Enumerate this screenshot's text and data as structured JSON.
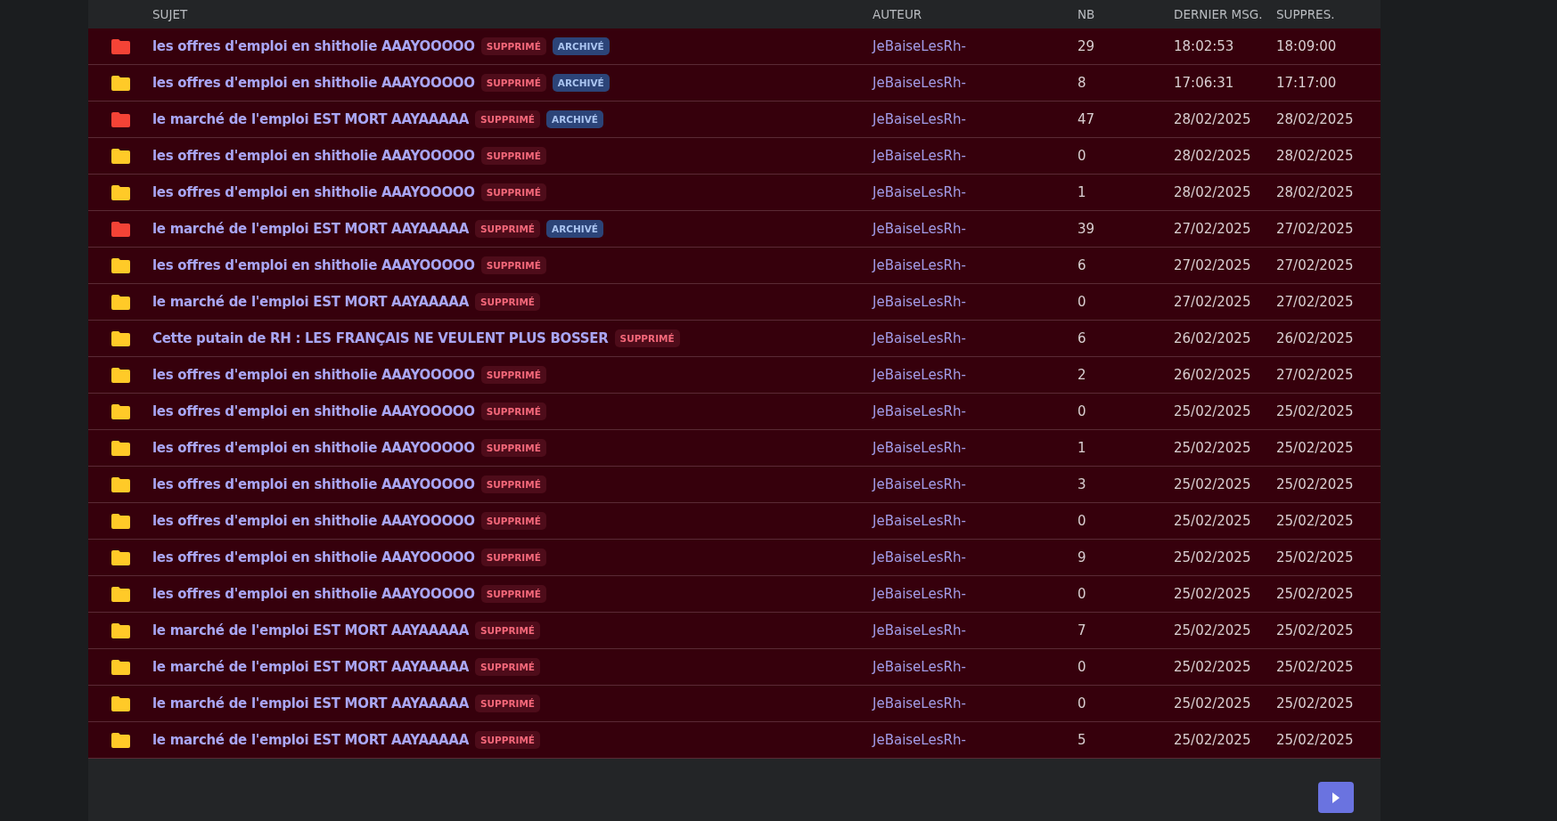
{
  "table": {
    "columns": [
      "SUJET",
      "AUTEUR",
      "NB",
      "DERNIER MSG.",
      "SUPPRES."
    ],
    "rows": [
      {
        "color": "#f44336",
        "subject": "les offres d'emploi en shitholie AAAYOOOOO",
        "badges": [
          {
            "kind": "deleted",
            "label": "SUPPRIMÉ"
          },
          {
            "kind": "archived",
            "label": "ARCHIVÉ"
          }
        ],
        "author": "JeBaiseLesRh-",
        "count": "29",
        "last": "18:02:53",
        "deleted_at": "18:09:00"
      },
      {
        "color": "#ffca28",
        "subject": "les offres d'emploi en shitholie AAAYOOOOO",
        "badges": [
          {
            "kind": "deleted",
            "label": "SUPPRIMÉ"
          },
          {
            "kind": "archived",
            "label": "ARCHIVÉ"
          }
        ],
        "author": "JeBaiseLesRh-",
        "count": "8",
        "last": "17:06:31",
        "deleted_at": "17:17:00"
      },
      {
        "color": "#f44336",
        "subject": "le marché de l'emploi EST MORT AAYAAAAA",
        "badges": [
          {
            "kind": "deleted",
            "label": "SUPPRIMÉ"
          },
          {
            "kind": "archived",
            "label": "ARCHIVÉ"
          }
        ],
        "author": "JeBaiseLesRh-",
        "count": "47",
        "last": "28/02/2025",
        "deleted_at": "28/02/2025"
      },
      {
        "color": "#ffca28",
        "subject": "les offres d'emploi en shitholie AAAYOOOOO",
        "badges": [
          {
            "kind": "deleted",
            "label": "SUPPRIMÉ"
          }
        ],
        "author": "JeBaiseLesRh-",
        "count": "0",
        "last": "28/02/2025",
        "deleted_at": "28/02/2025"
      },
      {
        "color": "#ffca28",
        "subject": "les offres d'emploi en shitholie AAAYOOOOO",
        "badges": [
          {
            "kind": "deleted",
            "label": "SUPPRIMÉ"
          }
        ],
        "author": "JeBaiseLesRh-",
        "count": "1",
        "last": "28/02/2025",
        "deleted_at": "28/02/2025"
      },
      {
        "color": "#f44336",
        "subject": "le marché de l'emploi EST MORT AAYAAAAA",
        "badges": [
          {
            "kind": "deleted",
            "label": "SUPPRIMÉ"
          },
          {
            "kind": "archived",
            "label": "ARCHIVÉ"
          }
        ],
        "author": "JeBaiseLesRh-",
        "count": "39",
        "last": "27/02/2025",
        "deleted_at": "27/02/2025"
      },
      {
        "color": "#ffca28",
        "subject": "les offres d'emploi en shitholie AAAYOOOOO",
        "badges": [
          {
            "kind": "deleted",
            "label": "SUPPRIMÉ"
          }
        ],
        "author": "JeBaiseLesRh-",
        "count": "6",
        "last": "27/02/2025",
        "deleted_at": "27/02/2025"
      },
      {
        "color": "#ffca28",
        "subject": "le marché de l'emploi EST MORT AAYAAAAA",
        "badges": [
          {
            "kind": "deleted",
            "label": "SUPPRIMÉ"
          }
        ],
        "author": "JeBaiseLesRh-",
        "count": "0",
        "last": "27/02/2025",
        "deleted_at": "27/02/2025"
      },
      {
        "color": "#ffca28",
        "subject": "Cette putain de RH : LES FRANÇAIS NE VEULENT PLUS BOSSER",
        "badges": [
          {
            "kind": "deleted",
            "label": "SUPPRIMÉ"
          }
        ],
        "author": "JeBaiseLesRh-",
        "count": "6",
        "last": "26/02/2025",
        "deleted_at": "26/02/2025"
      },
      {
        "color": "#ffca28",
        "subject": "les offres d'emploi en shitholie AAAYOOOOO",
        "badges": [
          {
            "kind": "deleted",
            "label": "SUPPRIMÉ"
          }
        ],
        "author": "JeBaiseLesRh-",
        "count": "2",
        "last": "26/02/2025",
        "deleted_at": "27/02/2025"
      },
      {
        "color": "#ffca28",
        "subject": "les offres d'emploi en shitholie AAAYOOOOO",
        "badges": [
          {
            "kind": "deleted",
            "label": "SUPPRIMÉ"
          }
        ],
        "author": "JeBaiseLesRh-",
        "count": "0",
        "last": "25/02/2025",
        "deleted_at": "25/02/2025"
      },
      {
        "color": "#ffca28",
        "subject": "les offres d'emploi en shitholie AAAYOOOOO",
        "badges": [
          {
            "kind": "deleted",
            "label": "SUPPRIMÉ"
          }
        ],
        "author": "JeBaiseLesRh-",
        "count": "1",
        "last": "25/02/2025",
        "deleted_at": "25/02/2025"
      },
      {
        "color": "#ffca28",
        "subject": "les offres d'emploi en shitholie AAAYOOOOO",
        "badges": [
          {
            "kind": "deleted",
            "label": "SUPPRIMÉ"
          }
        ],
        "author": "JeBaiseLesRh-",
        "count": "3",
        "last": "25/02/2025",
        "deleted_at": "25/02/2025"
      },
      {
        "color": "#ffca28",
        "subject": "les offres d'emploi en shitholie AAAYOOOOO",
        "badges": [
          {
            "kind": "deleted",
            "label": "SUPPRIMÉ"
          }
        ],
        "author": "JeBaiseLesRh-",
        "count": "0",
        "last": "25/02/2025",
        "deleted_at": "25/02/2025"
      },
      {
        "color": "#ffca28",
        "subject": "les offres d'emploi en shitholie AAAYOOOOO",
        "badges": [
          {
            "kind": "deleted",
            "label": "SUPPRIMÉ"
          }
        ],
        "author": "JeBaiseLesRh-",
        "count": "9",
        "last": "25/02/2025",
        "deleted_at": "25/02/2025"
      },
      {
        "color": "#ffca28",
        "subject": "les offres d'emploi en shitholie AAAYOOOOO",
        "badges": [
          {
            "kind": "deleted",
            "label": "SUPPRIMÉ"
          }
        ],
        "author": "JeBaiseLesRh-",
        "count": "0",
        "last": "25/02/2025",
        "deleted_at": "25/02/2025"
      },
      {
        "color": "#ffca28",
        "subject": "le marché de l'emploi EST MORT AAYAAAAA",
        "badges": [
          {
            "kind": "deleted",
            "label": "SUPPRIMÉ"
          }
        ],
        "author": "JeBaiseLesRh-",
        "count": "7",
        "last": "25/02/2025",
        "deleted_at": "25/02/2025"
      },
      {
        "color": "#ffca28",
        "subject": "le marché de l'emploi EST MORT AAYAAAAA",
        "badges": [
          {
            "kind": "deleted",
            "label": "SUPPRIMÉ"
          }
        ],
        "author": "JeBaiseLesRh-",
        "count": "0",
        "last": "25/02/2025",
        "deleted_at": "25/02/2025"
      },
      {
        "color": "#ffca28",
        "subject": "le marché de l'emploi EST MORT AAYAAAAA",
        "badges": [
          {
            "kind": "deleted",
            "label": "SUPPRIMÉ"
          }
        ],
        "author": "JeBaiseLesRh-",
        "count": "0",
        "last": "25/02/2025",
        "deleted_at": "25/02/2025"
      },
      {
        "color": "#ffca28",
        "subject": "le marché de l'emploi EST MORT AAYAAAAA",
        "badges": [
          {
            "kind": "deleted",
            "label": "SUPPRIMÉ"
          }
        ],
        "author": "JeBaiseLesRh-",
        "count": "5",
        "last": "25/02/2025",
        "deleted_at": "25/02/2025"
      }
    ]
  }
}
